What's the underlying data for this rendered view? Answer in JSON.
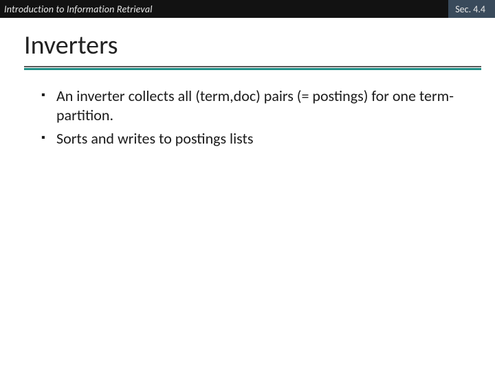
{
  "header": {
    "course": "Introduction to Information Retrieval",
    "section": "Sec. 4.4"
  },
  "title": "Inverters",
  "bullets": [
    "An inverter collects all (term,doc) pairs (= postings) for one term-partition.",
    "Sorts and writes to postings lists"
  ]
}
